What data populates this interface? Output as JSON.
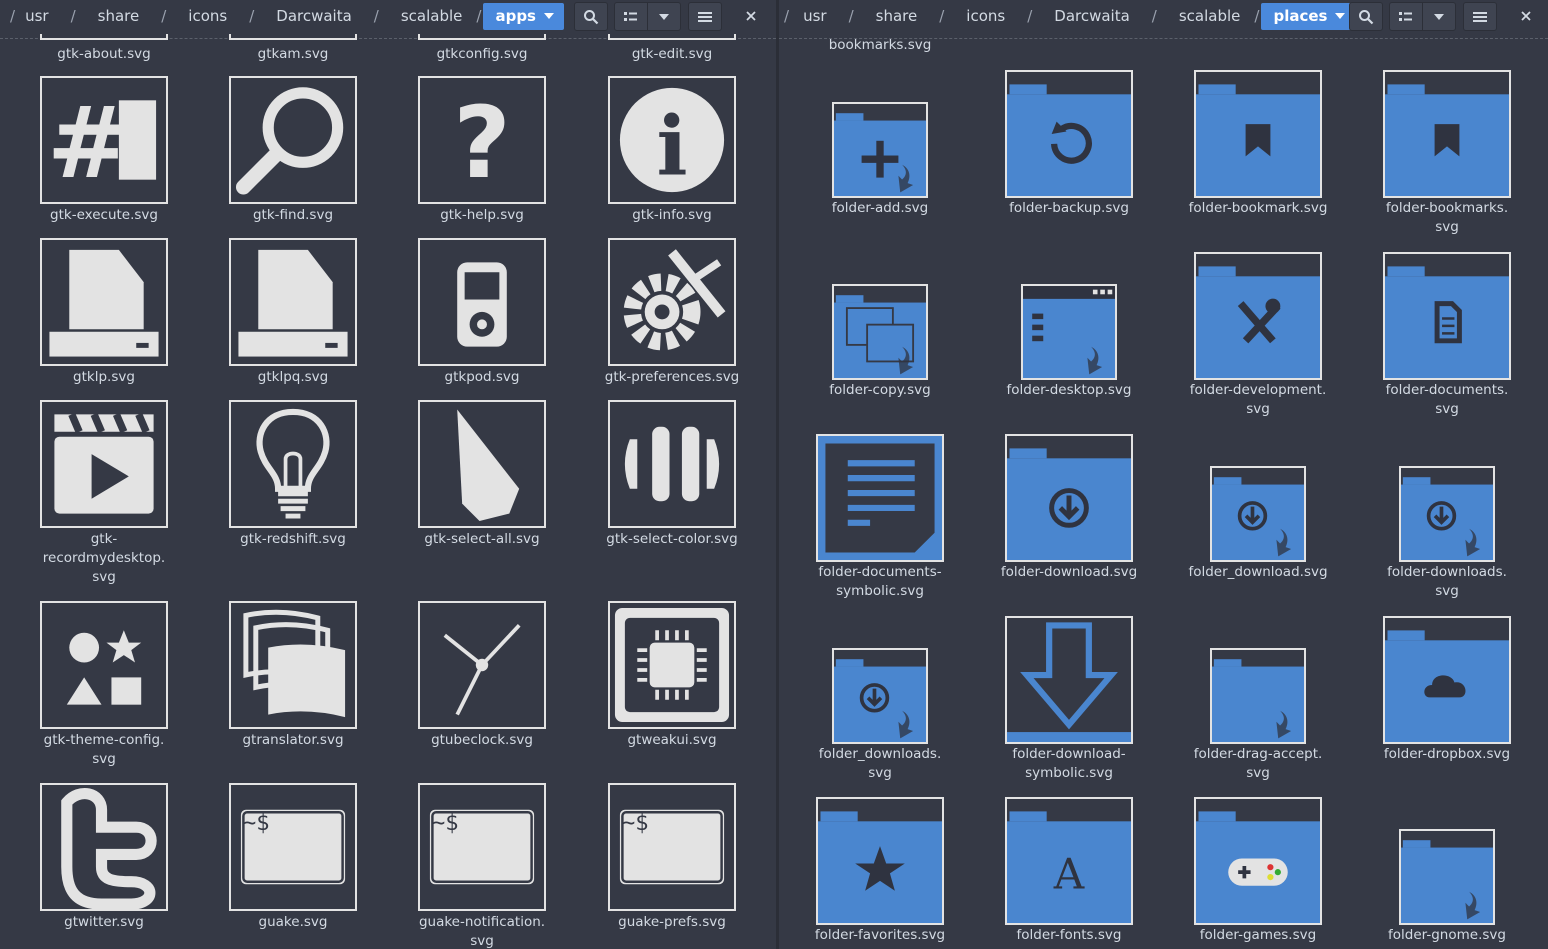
{
  "left": {
    "breadcrumb": [
      "usr",
      "share",
      "icons",
      "Darcwaita",
      "scalable"
    ],
    "active": "apps",
    "items": [
      {
        "label": "gtk-about.svg"
      },
      {
        "label": "gtkam.svg"
      },
      {
        "label": "gtkconfig.svg"
      },
      {
        "label": "gtk-edit.svg"
      },
      {
        "label": "gtk-execute.svg",
        "icon": "execute-icon"
      },
      {
        "label": "gtk-find.svg",
        "icon": "magnifier-icon"
      },
      {
        "label": "gtk-help.svg",
        "icon": "help-icon"
      },
      {
        "label": "gtk-info.svg",
        "icon": "info-icon"
      },
      {
        "label": "gtklp.svg",
        "icon": "printer-icon"
      },
      {
        "label": "gtklpq.svg",
        "icon": "printer-queue-icon"
      },
      {
        "label": "gtkpod.svg",
        "icon": "ipod-icon"
      },
      {
        "label": "gtk-preferences.svg",
        "icon": "preferences-icon"
      },
      {
        "label": "gtk-recordmydesktop.svg",
        "icon": "clapperboard-icon",
        "l1": "gtk-",
        "l2": "recordmydesktop.",
        "l3": "svg"
      },
      {
        "label": "gtk-redshift.svg",
        "icon": "bulb-icon"
      },
      {
        "label": "gtk-select-all.svg",
        "icon": "cursor-icon"
      },
      {
        "label": "gtk-select-color.svg",
        "icon": "color-bars-icon"
      },
      {
        "label": "gtk-theme-config.svg",
        "icon": "shapes-icon",
        "l1": "gtk-theme-config.",
        "l2": "svg"
      },
      {
        "label": "gtranslator.svg",
        "icon": "flags-icon"
      },
      {
        "label": "gtubeclock.svg",
        "icon": "clock-icon"
      },
      {
        "label": "gtweakui.svg",
        "icon": "chip-icon"
      },
      {
        "label": "gtwitter.svg",
        "icon": "twitter-icon"
      },
      {
        "label": "guake.svg",
        "icon": "terminal-icon"
      },
      {
        "label": "guake-notification.svg",
        "icon": "terminal-icon",
        "l1": "guake-notification.",
        "l2": "svg"
      },
      {
        "label": "guake-prefs.svg",
        "icon": "terminal-icon"
      }
    ],
    "prompt": "~$"
  },
  "right": {
    "breadcrumb": [
      "usr",
      "share",
      "icons",
      "Darcwaita",
      "scalable"
    ],
    "active": "places",
    "items": [
      {
        "label": "bookmarks.svg"
      },
      {
        "label": "folder-add.svg",
        "icon": "folder-add-icon"
      },
      {
        "label": "folder-backup.svg",
        "icon": "folder-backup-icon"
      },
      {
        "label": "folder-bookmark.svg",
        "icon": "folder-bookmark-icon"
      },
      {
        "label": "folder-bookmarks.svg",
        "icon": "folder-bookmarks-icon",
        "l1": "folder-bookmarks.",
        "l2": "svg"
      },
      {
        "label": "folder-copy.svg",
        "icon": "folder-copy-icon"
      },
      {
        "label": "folder-desktop.svg",
        "icon": "folder-desktop-icon"
      },
      {
        "label": "folder-development.svg",
        "icon": "folder-development-icon",
        "l1": "folder-development.",
        "l2": "svg"
      },
      {
        "label": "folder-documents.svg",
        "icon": "folder-documents-icon",
        "l1": "folder-documents.",
        "l2": "svg"
      },
      {
        "label": "folder-documents-symbolic.svg",
        "icon": "document-symbolic-icon",
        "l1": "folder-documents-",
        "l2": "symbolic.svg"
      },
      {
        "label": "folder-download.svg",
        "icon": "folder-download-icon"
      },
      {
        "label": "folder_download.svg",
        "icon": "folder-download-link-icon"
      },
      {
        "label": "folder-downloads.svg",
        "icon": "folder-downloads-icon",
        "l1": "folder-downloads.",
        "l2": "svg"
      },
      {
        "label": "folder_downloads.svg",
        "icon": "folder-downloads-link-icon",
        "l1": "folder_downloads.",
        "l2": "svg"
      },
      {
        "label": "folder-download-symbolic.svg",
        "icon": "download-arrow-icon",
        "l1": "folder-download-",
        "l2": "symbolic.svg"
      },
      {
        "label": "folder-drag-accept.svg",
        "icon": "folder-drag-accept-icon",
        "l1": "folder-drag-accept.",
        "l2": "svg"
      },
      {
        "label": "folder-dropbox.svg",
        "icon": "folder-dropbox-icon"
      },
      {
        "label": "folder-favorites.svg",
        "icon": "folder-favorites-icon"
      },
      {
        "label": "folder-fonts.svg",
        "icon": "folder-fonts-icon"
      },
      {
        "label": "folder-games.svg",
        "icon": "folder-games-icon"
      },
      {
        "label": "folder-gnome.svg",
        "icon": "folder-gnome-icon"
      }
    ],
    "font_glyph": "A"
  },
  "colors": {
    "background": "#353945",
    "accent": "#4a89dc",
    "folder": "#4a86cf",
    "text": "#d3dae3",
    "icon": "#e3e3e3"
  }
}
